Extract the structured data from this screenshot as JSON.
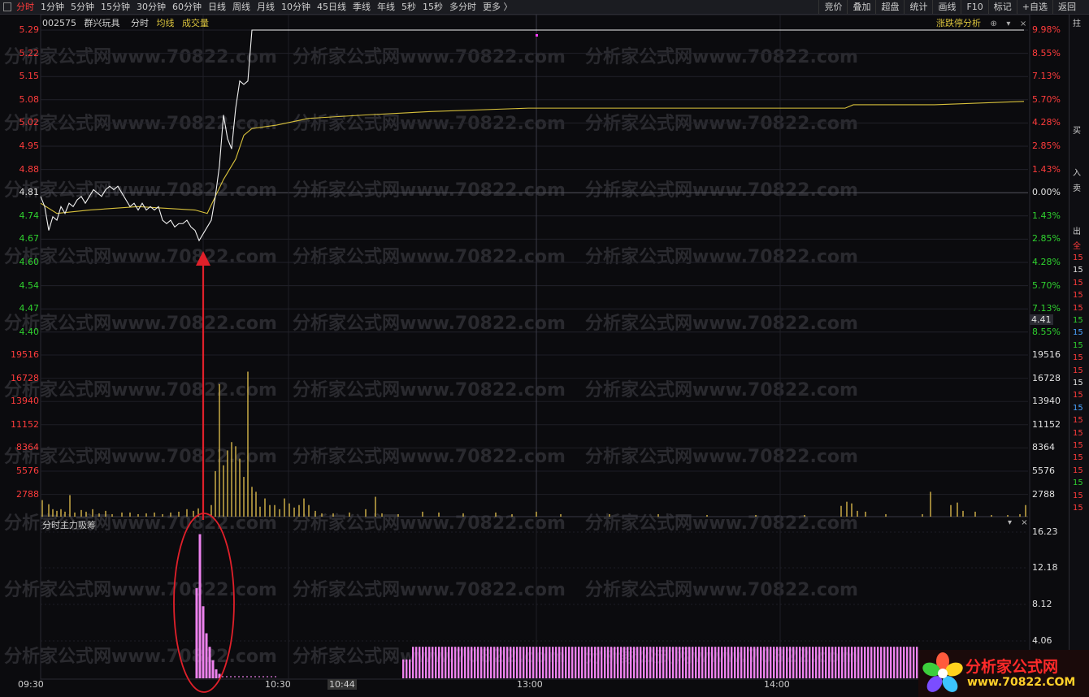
{
  "toolbar": {
    "left_items": [
      "分时",
      "1分钟",
      "5分钟",
      "15分钟",
      "30分钟",
      "60分钟",
      "日线",
      "周线",
      "月线",
      "10分钟",
      "45日线",
      "季线",
      "年线",
      "5秒",
      "15秒",
      "多分时",
      "更多 〉"
    ],
    "active_index": 0,
    "right_items": [
      "竞价",
      "叠加",
      "超盘",
      "统计",
      "画线",
      "F10",
      "标记",
      "+自选",
      "返回"
    ]
  },
  "info_bar": {
    "code": "002575",
    "name": "群兴玩具",
    "mode": "分时",
    "avg_label": "均线",
    "vol_label": "成交量"
  },
  "top_right": {
    "label": "涨跌停分析",
    "ctrl_plus": "⊕",
    "ctrl_down": "▾",
    "ctrl_close": "×"
  },
  "price_axis": {
    "left": [
      "5.29",
      "5.22",
      "5.15",
      "5.08",
      "5.02",
      "4.95",
      "4.88",
      "4.81",
      "4.74",
      "4.67",
      "4.60",
      "4.54",
      "4.47",
      "4.40"
    ],
    "right": [
      "9.98%",
      "8.55%",
      "7.13%",
      "5.70%",
      "4.28%",
      "2.85%",
      "1.43%",
      "0.00%",
      "1.43%",
      "2.85%",
      "4.28%",
      "5.70%",
      "7.13%",
      "8.55%"
    ],
    "current_price_tag": "4.41",
    "colors": {
      "up": "#ff3c3c",
      "flat": "#e0e0e0",
      "down": "#2fd12f"
    }
  },
  "volume_axis": {
    "labels": [
      "19516",
      "16728",
      "13940",
      "11152",
      "8364",
      "5576",
      "2788"
    ]
  },
  "indicator_panel": {
    "title": "分时主力吸筹",
    "ctrl_down": "▾",
    "ctrl_close": "×",
    "axis": [
      "16.23",
      "12.18",
      "8.12",
      "4.06"
    ]
  },
  "time_axis": [
    "09:30",
    "10:30",
    "10:44",
    "13:00",
    "14:00"
  ],
  "side_strip": {
    "items": [
      "拄",
      "买",
      "入",
      "卖",
      "出",
      "全"
    ],
    "rows": [
      "15",
      "15",
      "15",
      "15",
      "15",
      "15",
      "15",
      "15",
      "15",
      "15",
      "15",
      "15",
      "15",
      "15",
      "15",
      "15",
      "15",
      "15",
      "15",
      "15",
      "15"
    ],
    "row_colors": [
      "#ff3c3c",
      "#e0e0e0",
      "#ff3c3c",
      "#ff3c3c",
      "#ff3c3c",
      "#2fd12f",
      "#4aa3ff",
      "#2fd12f",
      "#ff3c3c",
      "#ff3c3c",
      "#e0e0e0",
      "#ff3c3c",
      "#4aa3ff",
      "#ff3c3c",
      "#ff3c3c",
      "#ff3c3c",
      "#ff3c3c",
      "#ff3c3c",
      "#2fd12f",
      "#ff3c3c",
      "#ff3c3c"
    ]
  },
  "watermark": "分析家公式网www.70822.com",
  "logo": {
    "line1": "分析家公式网",
    "line2": "www.70822.COM"
  },
  "chart_data": {
    "type": "line",
    "prev_close": 4.81,
    "ylim_price": [
      4.4,
      5.29
    ],
    "price_series": [
      [
        0,
        4.8
      ],
      [
        5,
        4.77
      ],
      [
        10,
        4.7
      ],
      [
        15,
        4.74
      ],
      [
        20,
        4.73
      ],
      [
        25,
        4.77
      ],
      [
        30,
        4.75
      ],
      [
        35,
        4.78
      ],
      [
        40,
        4.77
      ],
      [
        45,
        4.79
      ],
      [
        50,
        4.8
      ],
      [
        55,
        4.78
      ],
      [
        60,
        4.8
      ],
      [
        65,
        4.82
      ],
      [
        70,
        4.81
      ],
      [
        75,
        4.8
      ],
      [
        80,
        4.82
      ],
      [
        85,
        4.83
      ],
      [
        90,
        4.82
      ],
      [
        95,
        4.83
      ],
      [
        100,
        4.81
      ],
      [
        105,
        4.79
      ],
      [
        110,
        4.77
      ],
      [
        115,
        4.78
      ],
      [
        120,
        4.76
      ],
      [
        125,
        4.78
      ],
      [
        130,
        4.76
      ],
      [
        135,
        4.77
      ],
      [
        140,
        4.76
      ],
      [
        145,
        4.77
      ],
      [
        150,
        4.73
      ],
      [
        155,
        4.72
      ],
      [
        160,
        4.73
      ],
      [
        165,
        4.71
      ],
      [
        170,
        4.72
      ],
      [
        175,
        4.72
      ],
      [
        180,
        4.73
      ],
      [
        185,
        4.71
      ],
      [
        190,
        4.7
      ],
      [
        195,
        4.67
      ],
      [
        200,
        4.69
      ],
      [
        205,
        4.71
      ],
      [
        210,
        4.73
      ],
      [
        215,
        4.8
      ],
      [
        220,
        4.89
      ],
      [
        225,
        5.04
      ],
      [
        230,
        4.97
      ],
      [
        235,
        4.94
      ],
      [
        240,
        5.06
      ],
      [
        245,
        5.14
      ],
      [
        250,
        5.13
      ],
      [
        255,
        5.14
      ],
      [
        260,
        5.29
      ],
      [
        1210,
        5.29
      ]
    ],
    "avg_series": [
      [
        0,
        4.78
      ],
      [
        20,
        4.75
      ],
      [
        60,
        4.76
      ],
      [
        120,
        4.77
      ],
      [
        190,
        4.76
      ],
      [
        205,
        4.75
      ],
      [
        215,
        4.8
      ],
      [
        225,
        4.85
      ],
      [
        240,
        4.91
      ],
      [
        250,
        4.98
      ],
      [
        260,
        5.0
      ],
      [
        290,
        5.01
      ],
      [
        330,
        5.03
      ],
      [
        400,
        5.04
      ],
      [
        480,
        5.05
      ],
      [
        600,
        5.06
      ],
      [
        900,
        5.06
      ],
      [
        990,
        5.06
      ],
      [
        1000,
        5.07
      ],
      [
        1100,
        5.07
      ],
      [
        1210,
        5.08
      ]
    ],
    "volume_series": [
      [
        2,
        2000
      ],
      [
        10,
        1500
      ],
      [
        15,
        900
      ],
      [
        20,
        700
      ],
      [
        25,
        900
      ],
      [
        30,
        600
      ],
      [
        36,
        2600
      ],
      [
        42,
        500
      ],
      [
        50,
        800
      ],
      [
        56,
        600
      ],
      [
        64,
        900
      ],
      [
        72,
        400
      ],
      [
        80,
        700
      ],
      [
        88,
        300
      ],
      [
        100,
        500
      ],
      [
        110,
        500
      ],
      [
        120,
        300
      ],
      [
        130,
        400
      ],
      [
        140,
        500
      ],
      [
        150,
        300
      ],
      [
        160,
        500
      ],
      [
        170,
        600
      ],
      [
        180,
        900
      ],
      [
        188,
        700
      ],
      [
        194,
        1000
      ],
      [
        200,
        300
      ],
      [
        210,
        1400
      ],
      [
        215,
        5500
      ],
      [
        220,
        16000
      ],
      [
        225,
        6200
      ],
      [
        230,
        8000
      ],
      [
        235,
        9000
      ],
      [
        240,
        8500
      ],
      [
        245,
        7000
      ],
      [
        250,
        4800
      ],
      [
        255,
        17500
      ],
      [
        260,
        3600
      ],
      [
        265,
        3000
      ],
      [
        270,
        1200
      ],
      [
        276,
        2200
      ],
      [
        282,
        1400
      ],
      [
        288,
        1400
      ],
      [
        294,
        900
      ],
      [
        300,
        2200
      ],
      [
        306,
        1600
      ],
      [
        312,
        1100
      ],
      [
        318,
        1400
      ],
      [
        324,
        2200
      ],
      [
        330,
        1400
      ],
      [
        338,
        700
      ],
      [
        346,
        400
      ],
      [
        360,
        400
      ],
      [
        380,
        500
      ],
      [
        400,
        900
      ],
      [
        412,
        2400
      ],
      [
        420,
        400
      ],
      [
        440,
        300
      ],
      [
        470,
        600
      ],
      [
        490,
        500
      ],
      [
        520,
        400
      ],
      [
        560,
        500
      ],
      [
        580,
        300
      ],
      [
        610,
        600
      ],
      [
        640,
        300
      ],
      [
        700,
        300
      ],
      [
        760,
        300
      ],
      [
        820,
        200
      ],
      [
        880,
        200
      ],
      [
        940,
        200
      ],
      [
        985,
        1300
      ],
      [
        992,
        1800
      ],
      [
        998,
        1600
      ],
      [
        1005,
        700
      ],
      [
        1015,
        600
      ],
      [
        1040,
        300
      ],
      [
        1085,
        300
      ],
      [
        1095,
        3000
      ],
      [
        1120,
        1400
      ],
      [
        1128,
        1700
      ],
      [
        1135,
        700
      ],
      [
        1150,
        600
      ],
      [
        1170,
        200
      ],
      [
        1190,
        200
      ],
      [
        1205,
        300
      ],
      [
        1212,
        1400
      ]
    ],
    "indicator_series": [
      [
        192,
        10.0
      ],
      [
        196,
        16.0
      ],
      [
        200,
        8.0
      ],
      [
        204,
        5.0
      ],
      [
        208,
        3.5
      ],
      [
        212,
        2.0
      ],
      [
        216,
        1.0
      ],
      [
        220,
        0.5
      ]
    ],
    "indicator_tail_start": 445,
    "indicator_tail_end": 1080,
    "indicator_tail_value": 3.5,
    "ylim_indicator": [
      0,
      16.23
    ],
    "ylim_volume": [
      0,
      19516
    ]
  }
}
